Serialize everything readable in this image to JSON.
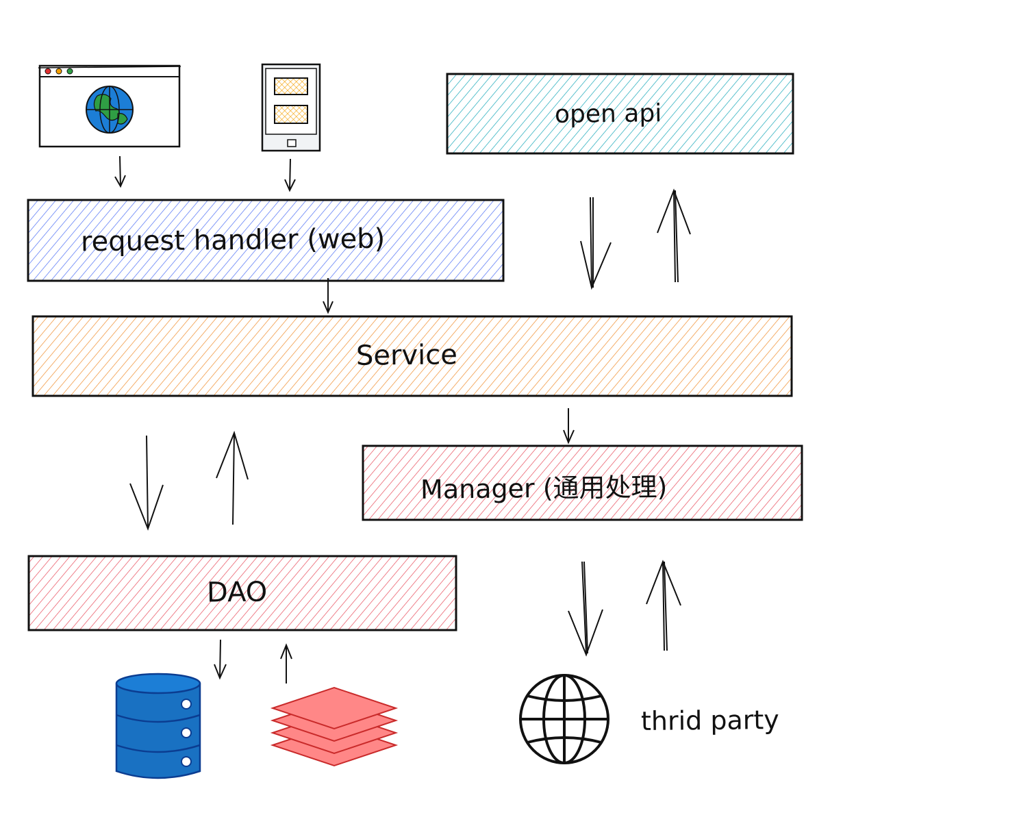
{
  "boxes": {
    "open_api": {
      "label": "open api",
      "color": "#16a7b8"
    },
    "request_handler": {
      "label": "request handler (web)",
      "color": "#4c6ef5"
    },
    "service": {
      "label": "Service",
      "color": "#f08c2b"
    },
    "manager": {
      "label": "Manager (通用处理)",
      "color": "#e84a5a"
    },
    "dao": {
      "label": "DAO",
      "color": "#e84a5a"
    }
  },
  "icons": {
    "browser": "browser-window-icon",
    "mobile": "mobile-device-icon",
    "database": "database-icon",
    "cache": "cache-stack-icon",
    "globe": "globe-icon"
  },
  "third_party_label": "thrid party",
  "colors": {
    "database": "#1971c2",
    "cache": "#ff6b6b",
    "globe_land": "#2f9e44",
    "globe_water": "#1c7ed6",
    "mobile_screen": "#f59f00"
  }
}
